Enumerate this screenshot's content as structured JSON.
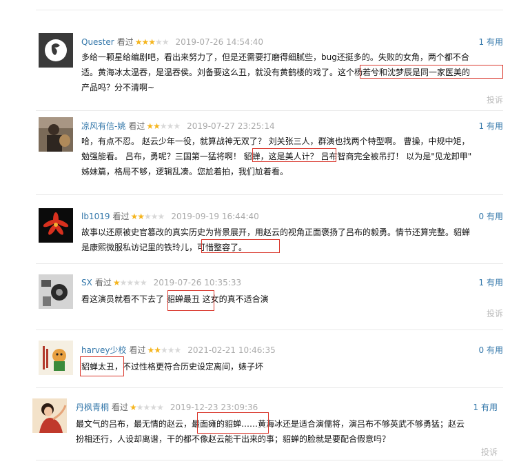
{
  "watched_label": "看过",
  "report_label": "投诉",
  "colors": {
    "link": "#3377aa",
    "star": "#f5b51e",
    "highlight_box": "#d9362b"
  },
  "reviews": [
    {
      "user": "Quester",
      "stars": 3,
      "time": "2019-07-26 14:54:40",
      "useful": "1 有用",
      "lines": [
        "多给一颗星给编剧吧，看出来努力了，但是还需要打磨得细腻些，bug还挺多的。失败的女角，两个都不合",
        "适。黄海冰太温吞，是温吞侯。刘备要这么丑，就没有黄鹤楼的戏了。这个杨若兮和沈梦辰是同一家医美的",
        "产品吗？分不清啊~"
      ]
    },
    {
      "user": "凉风有信-姚",
      "stars": 2,
      "time": "2019-07-27 23:25:14",
      "useful": "1 有用",
      "lines": [
        "哈，有点不忍。 赵云少年一役，就算战神无双了？ 刘关张三人，群演也找两个特型啊。 曹操，中规中矩，",
        "勉强能看。 吕布，勇呢？三国第一猛将啊！ 貂蝉，这是美人计？ 吕布智商完全被吊打！ 以为是\"见龙卸甲\"",
        "姊妹篇，格局不够，逻辑乱凑。您尬着拍，我们尬着看。"
      ]
    },
    {
      "user": "lb1019",
      "stars": 2,
      "time": "2019-09-19 16:44:40",
      "useful": "0 有用",
      "lines": [
        "故事以还原被史官篡改的真实历史为背景展开，用赵云的视角正面褒扬了吕布的毅勇。情节还算完整。貂蝉",
        "是康熙微服私访记里的铁玲儿，可惜整容了。"
      ]
    },
    {
      "user": "SX",
      "stars": 1,
      "time": "2019-07-26 10:35:33",
      "useful": "1 有用",
      "lines": [
        "看这演员就看不下去了 貂蝉最丑 这女的真不适合演"
      ]
    },
    {
      "user": "harvey少校",
      "stars": 2,
      "time": "2021-02-21 10:46:35",
      "useful": "0 有用",
      "lines": [
        "貂蝉太丑，不过性格更符合历史设定离间，婊子坏"
      ]
    },
    {
      "user": "丹枫青桐",
      "stars": 1,
      "time": "2019-12-23 23:09:36",
      "useful": "1 有用",
      "lines": [
        "最文气的吕布，最无情的赵云，最面瘫的貂蝉……黄海冰还是适合演儒将，演吕布不够英武不够勇猛；赵云",
        "扮相还行，人设却离谱，干的都不像赵云能干出来的事；貂蝉的脸就是要配合假意吗？"
      ]
    }
  ]
}
